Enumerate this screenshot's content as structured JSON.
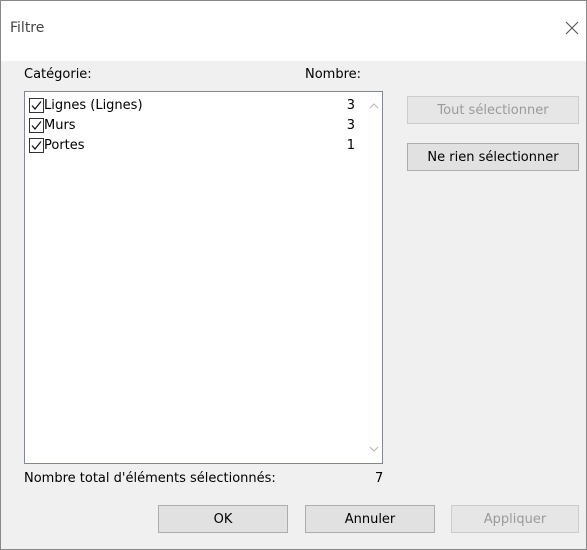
{
  "window": {
    "title": "Filtre"
  },
  "list": {
    "category_header": "Catégorie:",
    "count_header": "Nombre:",
    "items": [
      {
        "label": "Lignes (Lignes)",
        "count": "3",
        "checked": true
      },
      {
        "label": "Murs",
        "count": "3",
        "checked": true
      },
      {
        "label": "Portes",
        "count": "1",
        "checked": true
      }
    ]
  },
  "buttons": {
    "select_all": "Tout sélectionner",
    "select_none": "Ne rien sélectionner",
    "ok": "OK",
    "cancel": "Annuler",
    "apply": "Appliquer"
  },
  "footer": {
    "total_label": "Nombre total d'éléments sélectionnés:",
    "total_value": "7"
  },
  "icons": {
    "close": "close-icon",
    "checkbox": "checkmark-icon",
    "scroll_up": "chevron-up-icon",
    "scroll_down": "chevron-down-icon"
  }
}
